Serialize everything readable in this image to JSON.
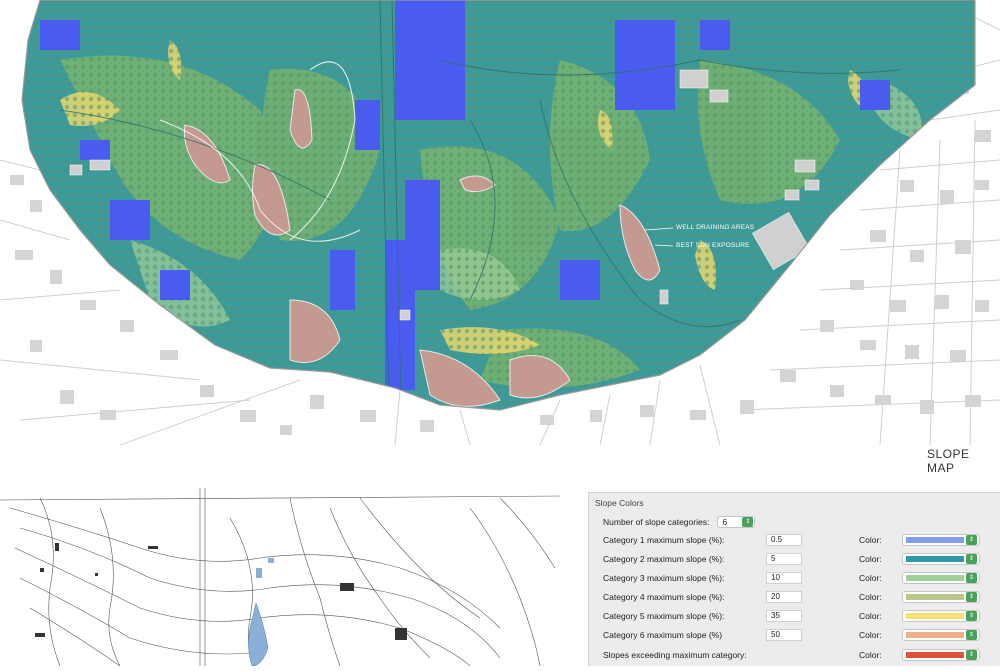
{
  "map": {
    "title": "SLOPE MAP",
    "annotations": {
      "well_draining": "WELL DRAINING AREAS",
      "best_sun": "BEST SUN EXPOSURE"
    }
  },
  "slope_colors_panel": {
    "title": "Slope Colors",
    "number_label": "Number of slope categories:",
    "number_value": "6",
    "color_label": "Color:",
    "categories": [
      {
        "label": "Category 1 maximum slope (%):",
        "value": "0.5",
        "color": "#7f9ef0"
      },
      {
        "label": "Category 2 maximum slope (%):",
        "value": "5",
        "color": "#2f9aa5"
      },
      {
        "label": "Category 3 maximum slope (%):",
        "value": "10",
        "color": "#9ed09a"
      },
      {
        "label": "Category 4 maximum slope (%):",
        "value": "20",
        "color": "#b8c78a"
      },
      {
        "label": "Category 5 maximum slope (%):",
        "value": "35",
        "color": "#f5e37a"
      },
      {
        "label": "Category 6 maximum slope (%)",
        "value": "50",
        "color": "#eeb08a"
      }
    ],
    "exceeding": {
      "label": "Slopes exceeding maximum category:",
      "color": "#e0503a"
    }
  },
  "colors": {
    "flat_blue": "#4a5cf0",
    "teal": "#3a9a9c",
    "green": "#7fb86a",
    "yellow": "#e8d870",
    "salmon": "#c49a90",
    "building_gray": "#c9c9c9"
  }
}
